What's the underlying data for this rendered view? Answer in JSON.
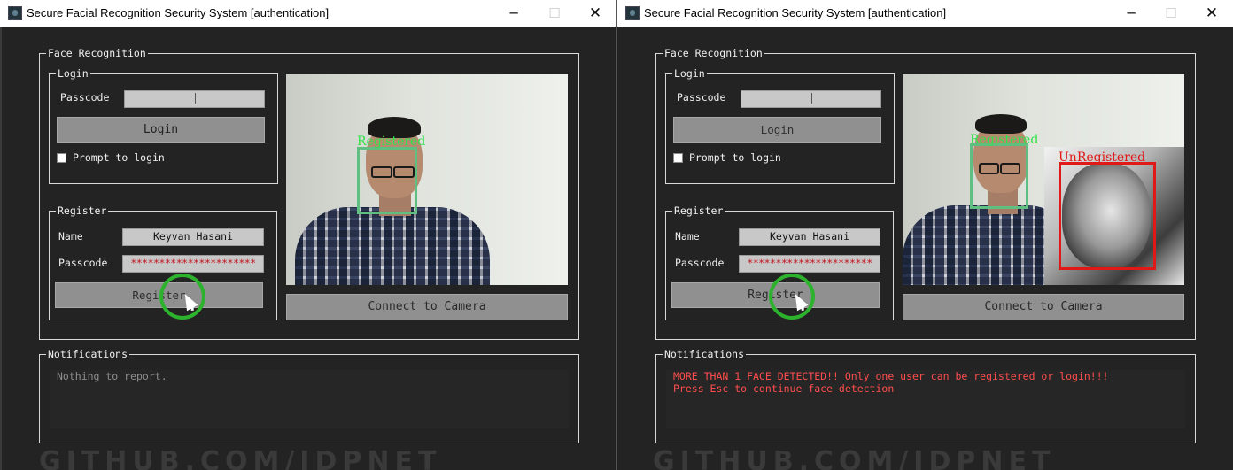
{
  "windows": [
    {
      "title": "Secure Facial Recognition Security System [authentication]",
      "controls": {
        "minimize": "─",
        "maximize": "☐",
        "close": "✕"
      },
      "face_group_label": "Face Recognition",
      "login": {
        "group_label": "Login",
        "passcode_label": "Passcode",
        "passcode_value": "",
        "login_button": "Login",
        "prompt_label": "Prompt to login",
        "prompt_checked": false
      },
      "register": {
        "group_label": "Register",
        "name_label": "Name",
        "name_value": "Keyvan Hasani",
        "passcode_label": "Passcode",
        "passcode_value": "**********************",
        "register_button": "Register"
      },
      "camera": {
        "faces": [
          {
            "label": "Registered",
            "color": "#33e24a"
          }
        ],
        "connect_button": "Connect to Camera"
      },
      "notifications": {
        "group_label": "Notifications",
        "text": "Nothing to report."
      },
      "watermark": "GITHUB.COM/IDPNET"
    },
    {
      "title": "Secure Facial Recognition Security System [authentication]",
      "controls": {
        "minimize": "─",
        "maximize": "☐",
        "close": "✕"
      },
      "face_group_label": "Face Recognition",
      "login": {
        "group_label": "Login",
        "passcode_label": "Passcode",
        "passcode_value": "",
        "login_button": "Login",
        "prompt_label": "Prompt to login",
        "prompt_checked": false
      },
      "register": {
        "group_label": "Register",
        "name_label": "Name",
        "name_value": "Keyvan Hasani",
        "passcode_label": "Passcode",
        "passcode_value": "**********************",
        "register_button": "Register"
      },
      "camera": {
        "faces": [
          {
            "label": "Registered",
            "color": "#33e24a"
          },
          {
            "label": "UnRegistered",
            "color": "#e01818"
          }
        ],
        "connect_button": "Connect to Camera"
      },
      "notifications": {
        "group_label": "Notifications",
        "text": "MORE THAN 1 FACE DETECTED!! Only one user can be registered or login!!!\nPress Esc to continue face detection"
      },
      "watermark": "GITHUB.COM/IDPNET"
    }
  ]
}
